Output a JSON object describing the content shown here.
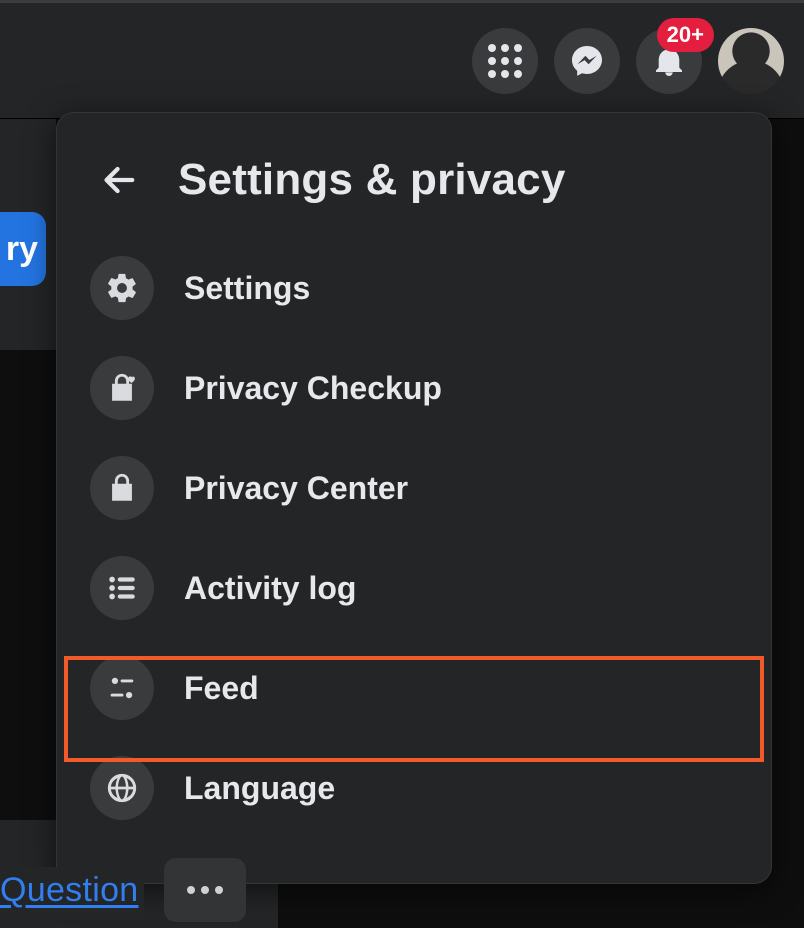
{
  "topbar": {
    "notification_badge": "20+"
  },
  "left_pill_text": "ry",
  "footer": {
    "question_text": " Question"
  },
  "panel": {
    "title": "Settings & privacy",
    "items": [
      {
        "key": "settings",
        "label": "Settings"
      },
      {
        "key": "privacy-checkup",
        "label": "Privacy Checkup"
      },
      {
        "key": "privacy-center",
        "label": "Privacy Center"
      },
      {
        "key": "activity-log",
        "label": "Activity log"
      },
      {
        "key": "feed",
        "label": "Feed"
      },
      {
        "key": "language",
        "label": "Language"
      }
    ]
  }
}
